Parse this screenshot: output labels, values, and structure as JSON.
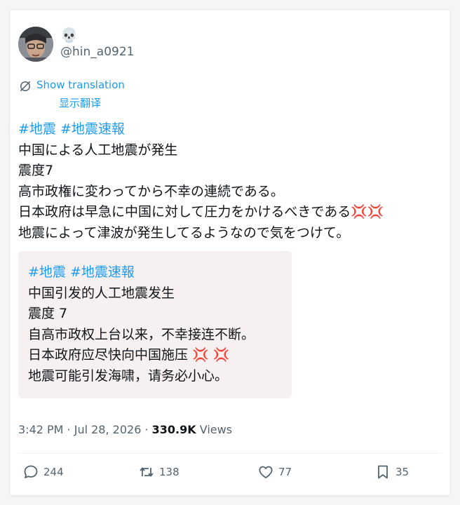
{
  "header": {
    "display_name": "💀",
    "handle": "@hin_a0921"
  },
  "translation": {
    "show_label": "Show translation",
    "show_label_cn": "显示翻译"
  },
  "post": {
    "hashtag1": "#地震",
    "hashtag2": "#地震速報",
    "line1": "中国による人工地震が発生",
    "line2": "震度7",
    "line3": "高市政権に変わってから不幸の連続である。",
    "line4": "日本政府は早急に中国に対して圧力をかけるべきである",
    "line5": "地震によって津波が発生してるようなので気をつけて。"
  },
  "translated": {
    "hashtag1": "#地震",
    "hashtag2": "#地震速報",
    "line1": "中国引发的人工地震发生",
    "line2": "震度 7",
    "line3": "自高市政权上台以来，不幸接连不断。",
    "line4": "日本政府应尽快向中国施压",
    "line5": "地震可能引发海啸，请务必小心。"
  },
  "meta": {
    "time": "3:42 PM",
    "sep": " · ",
    "date": "Jul 28, 2026",
    "sep2": " · ",
    "views_count": "330.9K",
    "views_label": " Views"
  },
  "actions": {
    "replies": "244",
    "reposts": "138",
    "likes": "77",
    "bookmarks": "35"
  },
  "colors": {
    "link": "#1d9bf0",
    "anger": "#e0245e",
    "muted": "#536471"
  }
}
